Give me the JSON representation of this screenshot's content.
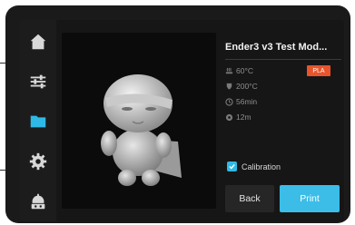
{
  "sidebar": {
    "items": [
      {
        "icon": "home-icon"
      },
      {
        "icon": "sliders-icon"
      },
      {
        "icon": "folder-icon",
        "active": true
      },
      {
        "icon": "gear-icon"
      },
      {
        "icon": "robot-icon"
      }
    ]
  },
  "file": {
    "name": "Ender3 v3 Test Mod...",
    "badge": "PLA"
  },
  "details": {
    "bed_temp": "60°C",
    "nozzle_temp": "200°C",
    "print_time": "56min",
    "filament": "12m"
  },
  "calibration": {
    "label": "Calibration",
    "checked": true
  },
  "buttons": {
    "back": "Back",
    "print": "Print"
  },
  "colors": {
    "accent": "#3bbde8",
    "badge": "#e8542c",
    "active_icon": "#2fb9e6"
  }
}
